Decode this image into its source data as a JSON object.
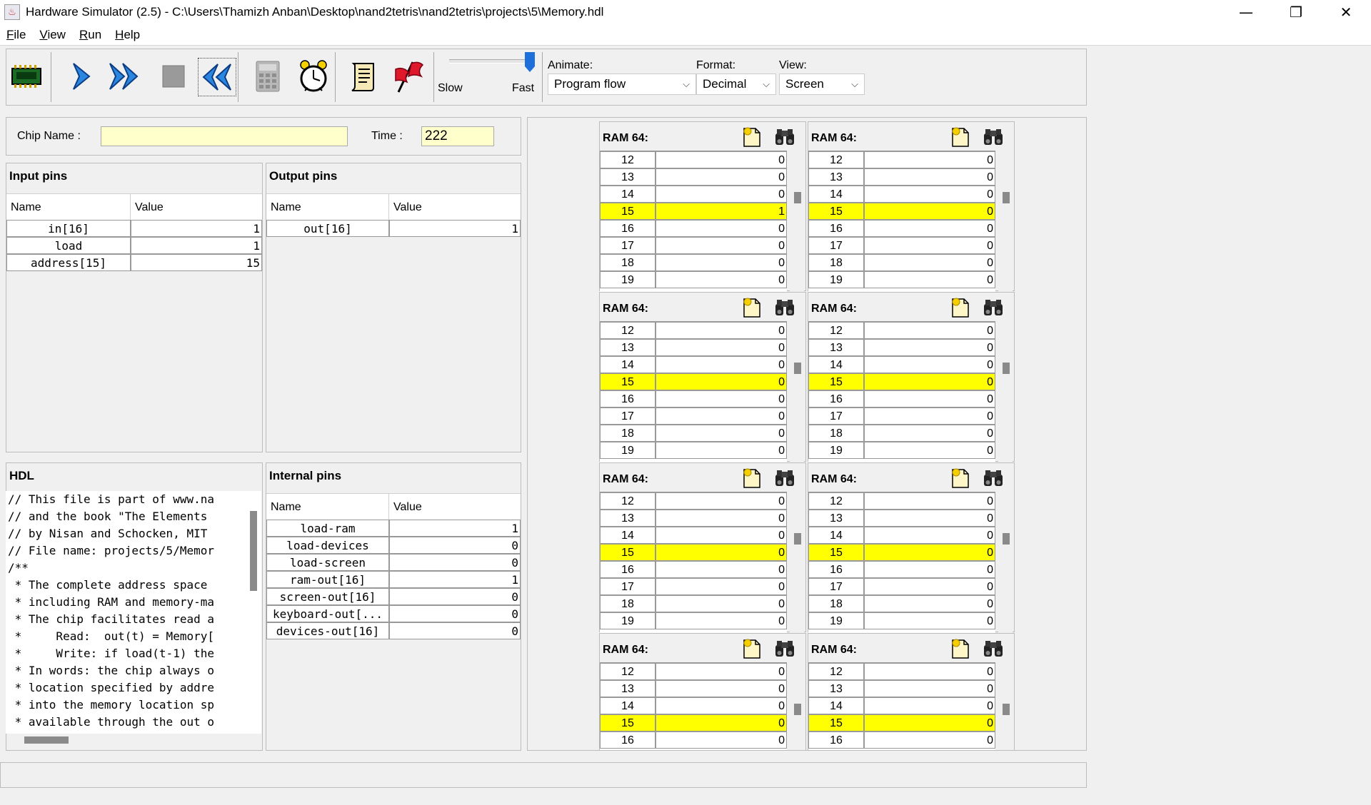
{
  "window": {
    "title": "Hardware Simulator (2.5) - C:\\Users\\Thamizh Anban\\Desktop\\nand2tetris\\nand2tetris\\projects\\5\\Memory.hdl",
    "minimize": "—",
    "maximize": "❐",
    "close": "✕"
  },
  "menu": {
    "file": {
      "key": "F",
      "rest": "ile"
    },
    "view": {
      "key": "V",
      "rest": "iew"
    },
    "run": {
      "key": "R",
      "rest": "un"
    },
    "help": {
      "key": "H",
      "rest": "elp"
    }
  },
  "toolbar": {
    "icons": [
      "load-chip-icon",
      "single-step-icon",
      "run-icon",
      "stop-icon",
      "reset-icon",
      "eval-calculator-icon",
      "tick-tock-clock-icon",
      "load-script-icon",
      "breakpoints-flag-icon"
    ],
    "speed": {
      "slow": "Slow",
      "fast": "Fast",
      "level": 1.0
    },
    "animate": {
      "label": "Animate:",
      "value": "Program flow"
    },
    "format": {
      "label": "Format:",
      "value": "Decimal"
    },
    "view": {
      "label": "View:",
      "value": "Screen"
    }
  },
  "chip": {
    "name_label": "Chip Name :",
    "name_value": "",
    "time_label": "Time :",
    "time_value": "222"
  },
  "input_pins": {
    "title": "Input pins",
    "col_name": "Name",
    "col_value": "Value",
    "rows": [
      {
        "name": "in[16]",
        "value": "1"
      },
      {
        "name": "load",
        "value": "1"
      },
      {
        "name": "address[15]",
        "value": "15"
      }
    ]
  },
  "output_pins": {
    "title": "Output pins",
    "col_name": "Name",
    "col_value": "Value",
    "rows": [
      {
        "name": "out[16]",
        "value": "1"
      }
    ]
  },
  "hdl": {
    "title": "HDL",
    "lines": [
      "// This file is part of www.na",
      "// and the book \"The Elements ",
      "// by Nisan and Schocken, MIT ",
      "// File name: projects/5/Memor",
      "/**",
      " * The complete address space ",
      " * including RAM and memory-ma",
      " * The chip facilitates read a",
      " *     Read:  out(t) = Memory[",
      " *     Write: if load(t-1) the",
      " * In words: the chip always o",
      " * location specified by addre",
      " * into the memory location sp",
      " * available through the out o"
    ]
  },
  "internal_pins": {
    "title": "Internal pins",
    "col_name": "Name",
    "col_value": "Value",
    "rows": [
      {
        "name": "load-ram",
        "value": "1"
      },
      {
        "name": "load-devices",
        "value": "0"
      },
      {
        "name": "load-screen",
        "value": "0"
      },
      {
        "name": "ram-out[16]",
        "value": "1"
      },
      {
        "name": "screen-out[16]",
        "value": "0"
      },
      {
        "name": "keyboard-out[...",
        "value": "0"
      },
      {
        "name": "devices-out[16]",
        "value": "0"
      }
    ]
  },
  "ram_panels": [
    {
      "title": "RAM 64:",
      "rows": [
        [
          "12",
          "0"
        ],
        [
          "13",
          "0"
        ],
        [
          "14",
          "0"
        ],
        [
          "15",
          "1"
        ],
        [
          "16",
          "0"
        ],
        [
          "17",
          "0"
        ],
        [
          "18",
          "0"
        ],
        [
          "19",
          "0"
        ]
      ]
    },
    {
      "title": "RAM 64:",
      "rows": [
        [
          "12",
          "0"
        ],
        [
          "13",
          "0"
        ],
        [
          "14",
          "0"
        ],
        [
          "15",
          "0"
        ],
        [
          "16",
          "0"
        ],
        [
          "17",
          "0"
        ],
        [
          "18",
          "0"
        ],
        [
          "19",
          "0"
        ]
      ]
    },
    {
      "title": "RAM 64:",
      "rows": [
        [
          "12",
          "0"
        ],
        [
          "13",
          "0"
        ],
        [
          "14",
          "0"
        ],
        [
          "15",
          "0"
        ],
        [
          "16",
          "0"
        ],
        [
          "17",
          "0"
        ],
        [
          "18",
          "0"
        ],
        [
          "19",
          "0"
        ]
      ]
    },
    {
      "title": "RAM 64:",
      "rows": [
        [
          "12",
          "0"
        ],
        [
          "13",
          "0"
        ],
        [
          "14",
          "0"
        ],
        [
          "15",
          "0"
        ],
        [
          "16",
          "0"
        ],
        [
          "17",
          "0"
        ],
        [
          "18",
          "0"
        ],
        [
          "19",
          "0"
        ]
      ]
    },
    {
      "title": "RAM 64:",
      "rows": [
        [
          "12",
          "0"
        ],
        [
          "13",
          "0"
        ],
        [
          "14",
          "0"
        ],
        [
          "15",
          "0"
        ],
        [
          "16",
          "0"
        ],
        [
          "17",
          "0"
        ],
        [
          "18",
          "0"
        ],
        [
          "19",
          "0"
        ]
      ]
    },
    {
      "title": "RAM 64:",
      "rows": [
        [
          "12",
          "0"
        ],
        [
          "13",
          "0"
        ],
        [
          "14",
          "0"
        ],
        [
          "15",
          "0"
        ],
        [
          "16",
          "0"
        ],
        [
          "17",
          "0"
        ],
        [
          "18",
          "0"
        ],
        [
          "19",
          "0"
        ]
      ]
    },
    {
      "title": "RAM 64:",
      "rows": [
        [
          "12",
          "0"
        ],
        [
          "13",
          "0"
        ],
        [
          "14",
          "0"
        ],
        [
          "15",
          "0"
        ],
        [
          "16",
          "0"
        ]
      ]
    },
    {
      "title": "RAM 64:",
      "rows": [
        [
          "12",
          "0"
        ],
        [
          "13",
          "0"
        ],
        [
          "14",
          "0"
        ],
        [
          "15",
          "0"
        ],
        [
          "16",
          "0"
        ]
      ]
    }
  ],
  "ram_highlight_address": "15",
  "colors": {
    "highlight": "#ffff00",
    "input_field": "#ffffcc",
    "accent_blue": "#1e6fd9"
  }
}
